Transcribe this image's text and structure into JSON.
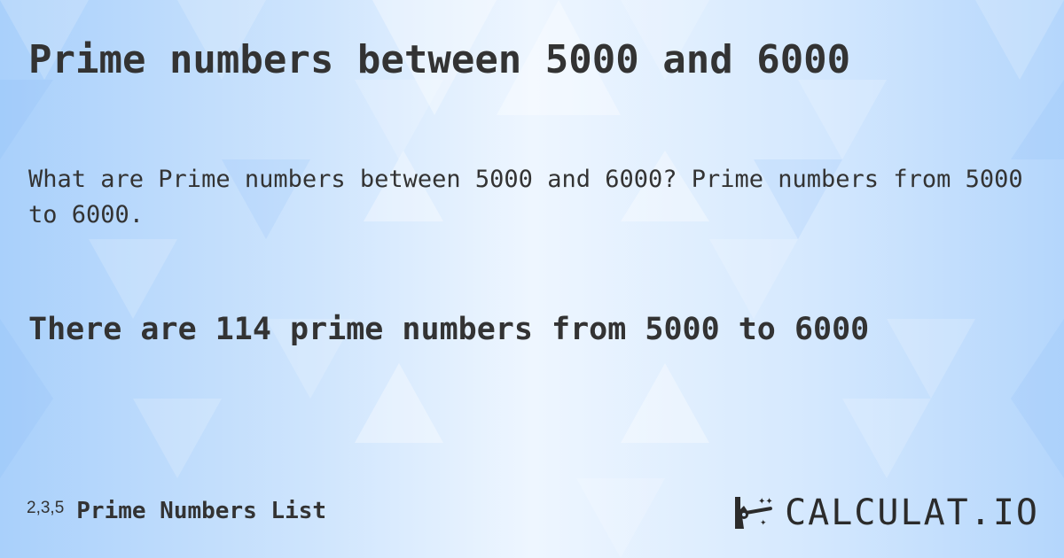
{
  "page": {
    "title": "Prime numbers between 5000 and 6000",
    "description": "What are Prime numbers between 5000 and 6000? Prime numbers from 5000 to 6000.",
    "answer": "There are  114 prime numbers from 5000 to 6000"
  },
  "footer": {
    "link_prefix": "2,3,5",
    "link_label": "Prime Numbers List",
    "logo_text": "CALCULAT.IO",
    "logo_icon": "magic-wand-hand-icon"
  },
  "colors": {
    "text": "#333333",
    "background_light": "#eef6ff",
    "background_blue": "#a9d0fb"
  }
}
